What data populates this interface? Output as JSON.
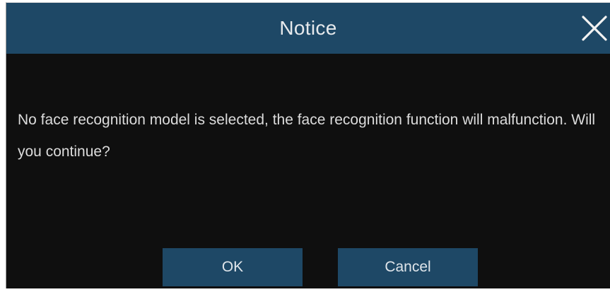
{
  "dialog": {
    "title": "Notice",
    "close_icon": "close-icon",
    "message": "No face recognition model is selected, the face recognition function will malfunction. Will you continue?",
    "ok_label": "OK",
    "cancel_label": "Cancel"
  },
  "colors": {
    "title_bar": "#1e4866",
    "button": "#1e4866",
    "background": "#0f0f0f",
    "text": "#dcdcdc"
  }
}
